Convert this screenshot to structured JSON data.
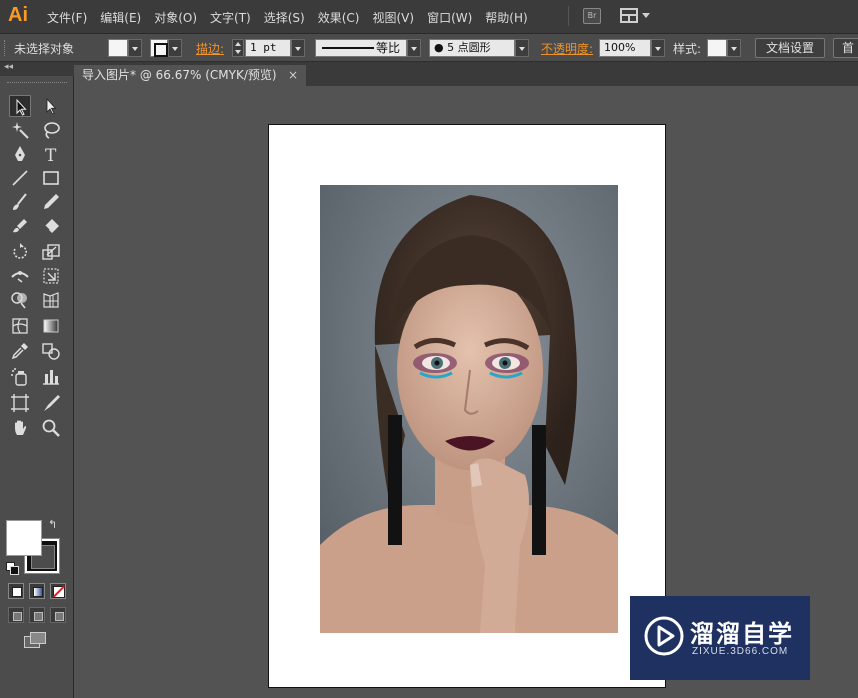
{
  "app": {
    "logo": "Ai",
    "bridge_label": "Br"
  },
  "menu": [
    "文件(F)",
    "编辑(E)",
    "对象(O)",
    "文字(T)",
    "选择(S)",
    "效果(C)",
    "视图(V)",
    "窗口(W)",
    "帮助(H)"
  ],
  "control_bar": {
    "selection_status": "未选择对象",
    "stroke_label": "描边:",
    "stroke_weight": "1 pt",
    "stroke_profile": "等比",
    "brush": "● 5 点圆形",
    "opacity_label": "不透明度:",
    "opacity_value": "100%",
    "style_label": "样式:",
    "document_setup_button": "文档设置",
    "next_button": "首"
  },
  "document_tab": {
    "title": "导入图片* @ 66.67% (CMYK/预览)",
    "close": "×"
  },
  "tools_panel": {
    "collapse": "◂◂",
    "tools": [
      "selection-tool",
      "direct-selection-tool",
      "magic-wand-tool",
      "lasso-tool",
      "pen-tool",
      "type-tool",
      "line-segment-tool",
      "rectangle-tool",
      "paintbrush-tool",
      "pencil-tool",
      "blob-brush-tool",
      "eraser-tool",
      "rotate-tool",
      "scale-tool",
      "width-tool",
      "free-transform-tool",
      "shape-builder-tool",
      "perspective-grid-tool",
      "mesh-tool",
      "gradient-tool",
      "eyedropper-tool",
      "blend-tool",
      "symbol-sprayer-tool",
      "column-graph-tool",
      "artboard-tool",
      "slice-tool",
      "hand-tool",
      "zoom-tool"
    ],
    "fill_color": "#ffffff",
    "stroke_color": "#111111"
  },
  "canvas": {
    "artboard_color": "#ffffff",
    "image": "portrait-photo"
  },
  "watermark": {
    "title": "溜溜自学",
    "subtitle": "ZIXUE.3D66.COM"
  },
  "colors": {
    "accent_orange": "#f0932a",
    "ui_dark": "#3b3b3b",
    "canvas_bg": "#535353",
    "watermark_bg": "#1f3160"
  }
}
